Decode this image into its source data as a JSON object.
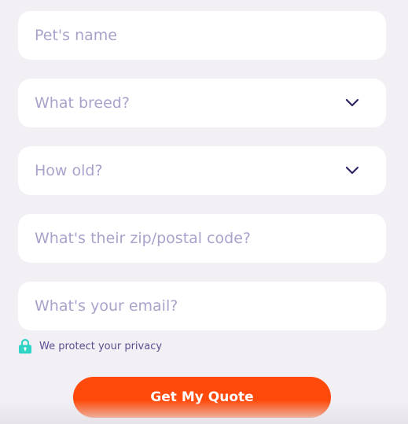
{
  "form": {
    "pet_name": {
      "placeholder": "Pet's name",
      "value": ""
    },
    "breed": {
      "placeholder": "What breed?",
      "icon": "chevron-down-icon"
    },
    "age": {
      "placeholder": "How old?",
      "icon": "chevron-down-icon"
    },
    "zip": {
      "placeholder": "What's their zip/postal code?",
      "value": ""
    },
    "email": {
      "placeholder": "What's your email?",
      "value": ""
    }
  },
  "privacy": {
    "icon": "lock-icon",
    "text": "We protect your privacy"
  },
  "cta": {
    "label": "Get My Quote"
  },
  "colors": {
    "background": "#f2f0f5",
    "field_background": "#ffffff",
    "placeholder": "#a9a3cc",
    "accent_dark": "#2e2464",
    "lock": "#2fd4c4",
    "cta": "#ff4a0b"
  }
}
